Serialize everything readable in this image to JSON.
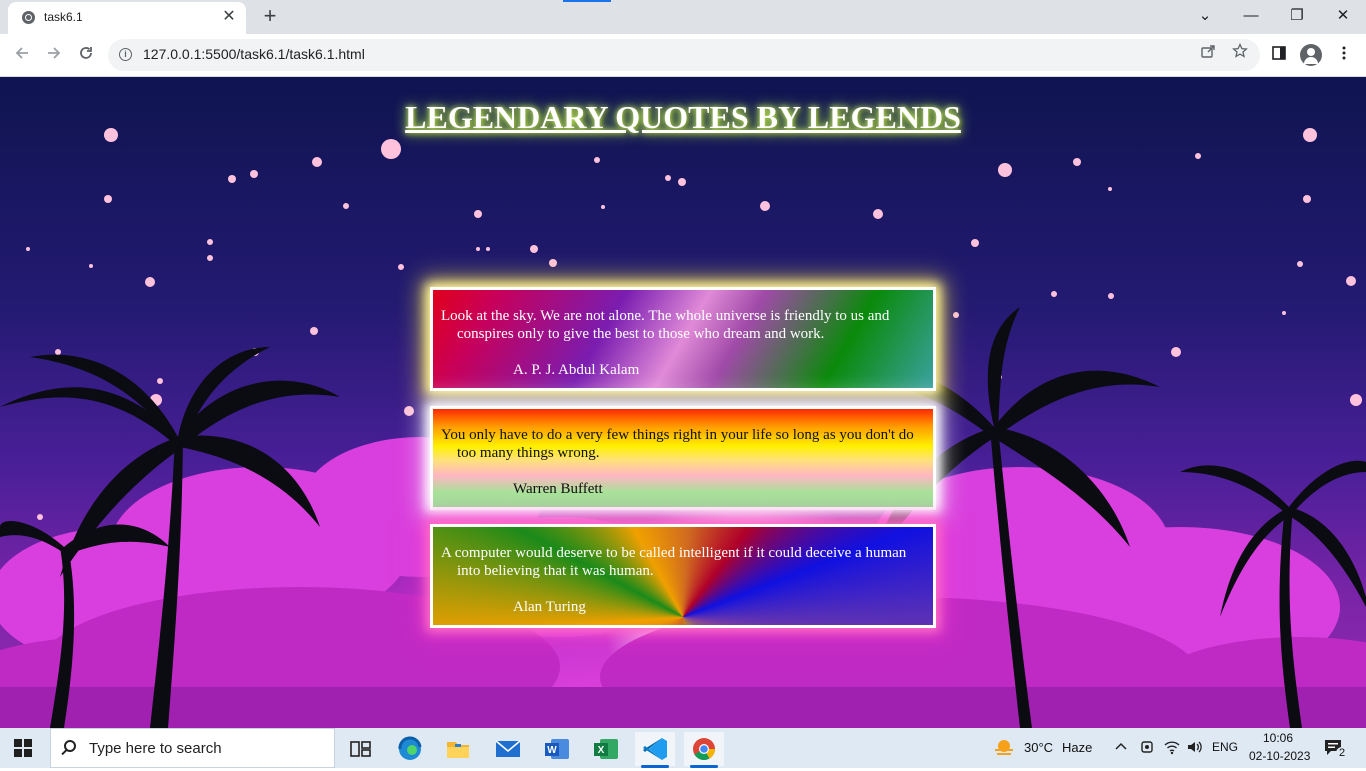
{
  "browser": {
    "tab_title": "task6.1",
    "tab_close": "✕",
    "new_tab": "+",
    "url": "127.0.0.1:5500/task6.1/task6.1.html",
    "window_controls": {
      "dropdown": "⌄",
      "minimize": "—",
      "restore": "❐",
      "close": "✕"
    }
  },
  "page": {
    "heading": "LEGENDARY QUOTES BY LEGENDS",
    "quotes": [
      {
        "text": "Look at the sky. We are not alone. The whole universe is friendly to us and conspires only to give the best to those who dream and work.",
        "author": "A. P. J. Abdul Kalam"
      },
      {
        "text": "You only have to do a very few things right in your life so long as you don't do too many things wrong.",
        "author": "Warren Buffett"
      },
      {
        "text": "A computer would deserve to be called intelligent if it could deceive a human into believing that it was human.",
        "author": "Alan Turing"
      }
    ]
  },
  "taskbar": {
    "search_placeholder": "Type here to search",
    "weather_temp": "30°C",
    "weather_desc": "Haze",
    "language": "ENG",
    "time": "10:06",
    "date": "02-10-2023",
    "notification_count": "2",
    "apps": [
      "task-view",
      "edge",
      "file-explorer",
      "mail",
      "word",
      "excel",
      "vscode",
      "chrome"
    ]
  },
  "colors": {
    "accent": "#1a73e8",
    "heading_glow": "#b9ff3a"
  }
}
